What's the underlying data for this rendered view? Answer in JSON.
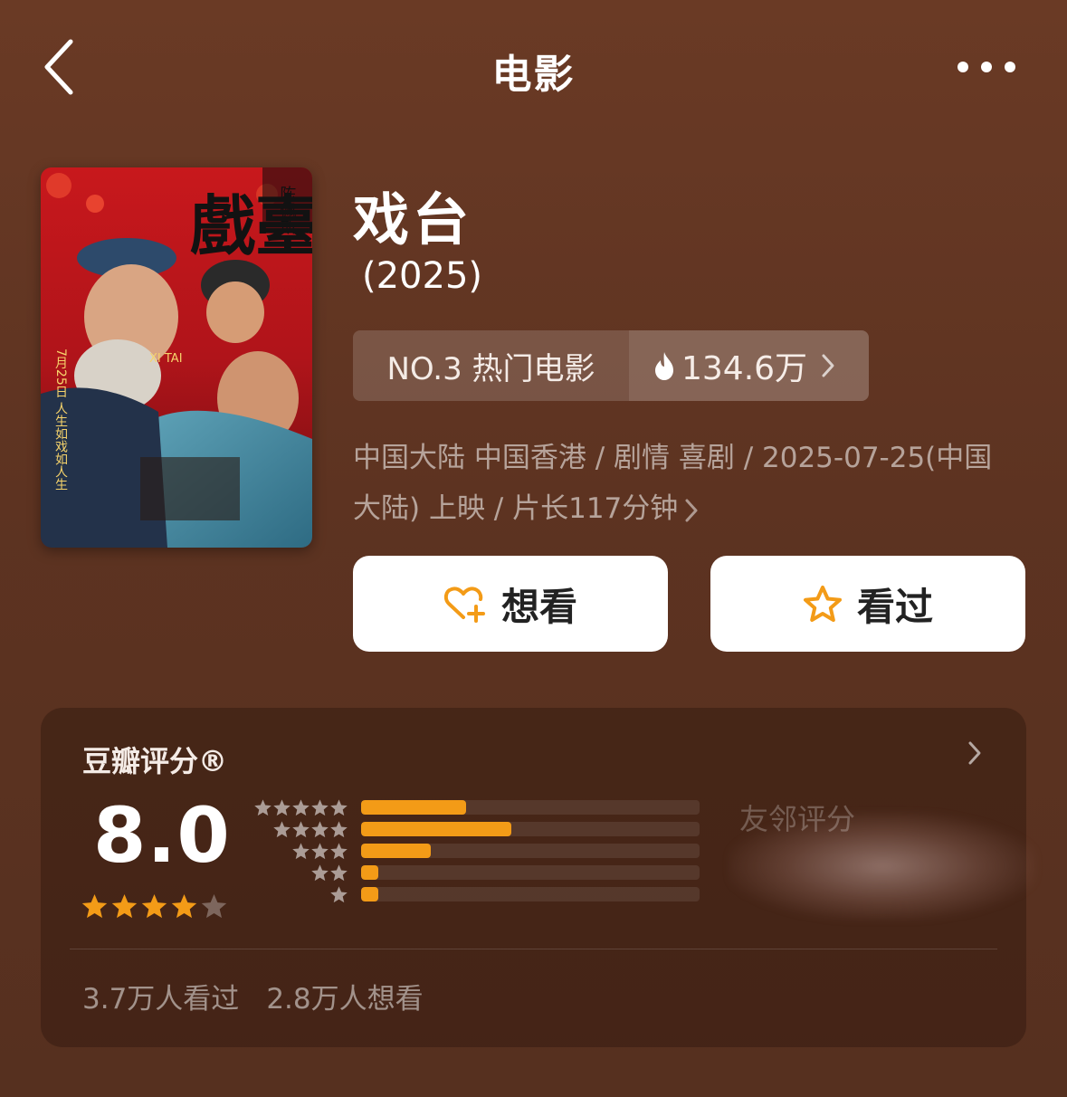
{
  "nav": {
    "title": "电影",
    "back_icon": "chevron-left-icon",
    "more_icon": "more-dots-icon"
  },
  "poster": {
    "headline": "戲臺",
    "romanization": "XI TAI",
    "director_credit": "陈佩斯",
    "release_line": "7月25日 人生如戏如人生"
  },
  "movie": {
    "title": "戏台",
    "year": "(2025)",
    "rank_label": "NO.3 热门电影",
    "heat_value": "134.6万",
    "meta_line1": "中国大陆 中国香港 / 剧情 喜剧 / 2025-07-25(中国",
    "meta_line2": "大陆) 上映 / 片长117分钟"
  },
  "actions": {
    "want_label": "想看",
    "seen_label": "看过"
  },
  "rating": {
    "title": "豆瓣评分®",
    "score": "8.0",
    "score_stars": 4,
    "distribution_fraction": [
      0.31,
      0.445,
      0.205,
      0.05,
      0.05
    ],
    "friends_label": "友邻评分",
    "watched": "3.7万人看过",
    "wishlist": "2.8万人想看"
  },
  "colors": {
    "background": "#5e3422",
    "accent_orange": "#f39b17",
    "button_bg": "#ffffff"
  }
}
